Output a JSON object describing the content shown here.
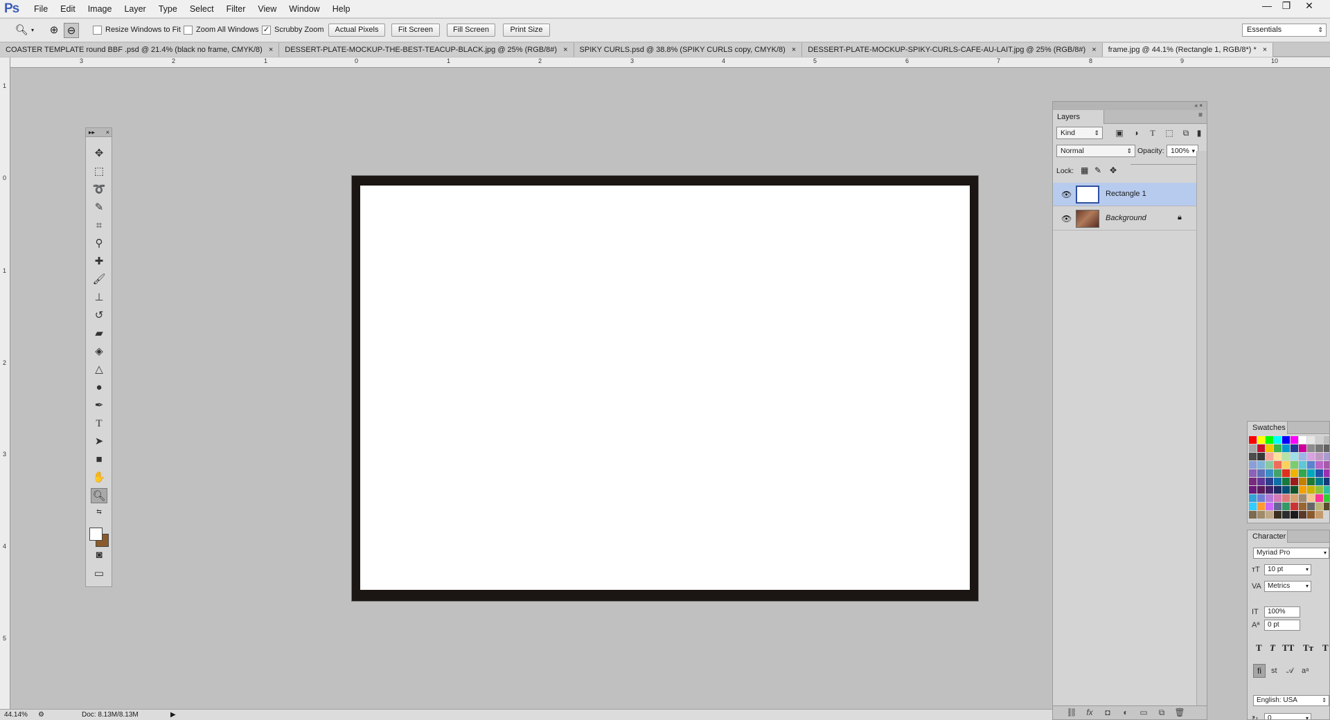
{
  "app": {
    "logo": "Ps"
  },
  "menu": [
    "File",
    "Edit",
    "Image",
    "Layer",
    "Type",
    "Select",
    "Filter",
    "View",
    "Window",
    "Help"
  ],
  "window_controls": {
    "minimize": "—",
    "restore": "❐",
    "close": "✕"
  },
  "options": {
    "resize_windows_label": "Resize Windows to Fit",
    "resize_windows_checked": false,
    "zoom_all_label": "Zoom All Windows",
    "zoom_all_checked": false,
    "scrubby_zoom_label": "Scrubby Zoom",
    "scrubby_zoom_checked": true,
    "actual_pixels": "Actual Pixels",
    "fit_screen": "Fit Screen",
    "fill_screen": "Fill Screen",
    "print_size": "Print Size",
    "workspace": "Essentials"
  },
  "tabs": [
    {
      "label": "COASTER TEMPLATE round BBF .psd @ 21.4% (black no frame, CMYK/8)",
      "active": false
    },
    {
      "label": "DESSERT-PLATE-MOCKUP-THE-BEST-TEACUP-BLACK.jpg @ 25% (RGB/8#)",
      "active": false
    },
    {
      "label": "SPIKY CURLS.psd @ 38.8% (SPIKY CURLS copy, CMYK/8)",
      "active": false
    },
    {
      "label": "DESSERT-PLATE-MOCKUP-SPIKY-CURLS-CAFE-AU-LAIT.jpg @ 25% (RGB/8#)",
      "active": false
    },
    {
      "label": "frame.jpg @ 44.1% (Rectangle 1, RGB/8*) *",
      "active": true
    }
  ],
  "ruler_h": [
    "3",
    "2",
    "1",
    "0",
    "1",
    "2",
    "3",
    "4",
    "5",
    "6",
    "7",
    "8",
    "9",
    "10"
  ],
  "ruler_v": [
    "1",
    "0",
    "1",
    "2",
    "3",
    "4",
    "5"
  ],
  "tools": [
    "move-tool",
    "marquee-tool",
    "lasso-tool",
    "quick-selection-tool",
    "crop-tool",
    "eyedropper-tool",
    "healing-brush-tool",
    "brush-tool",
    "clone-stamp-tool",
    "history-brush-tool",
    "eraser-tool",
    "paint-bucket-tool",
    "blur-tool",
    "dodge-tool",
    "pen-tool",
    "type-tool",
    "path-selection-tool",
    "rectangle-tool",
    "hand-tool",
    "zoom-tool"
  ],
  "colors": {
    "foreground": "#ffffff",
    "background": "#8b5a2b",
    "selection": "#b7cbef"
  },
  "layers_panel": {
    "title": "Layers",
    "filter_kind": "Kind",
    "blend_mode": "Normal",
    "opacity_label": "Opacity:",
    "opacity_value": "100%",
    "lock_label": "Lock:",
    "layers": [
      {
        "name": "Rectangle 1",
        "selected": true,
        "locked": false
      },
      {
        "name": "Background",
        "selected": false,
        "locked": true
      }
    ]
  },
  "swatches_panel": {
    "title": "Swatches"
  },
  "character_panel": {
    "title": "Character",
    "font_family": "Myriad Pro",
    "font_size": "10 pt",
    "kerning": "Metrics",
    "vertical_scale": "100%",
    "baseline_shift": "0 pt",
    "language": "English: USA",
    "extra_field": "0"
  },
  "status": {
    "zoom": "44.14%",
    "doc": "Doc: 8.13M/8.13M"
  }
}
